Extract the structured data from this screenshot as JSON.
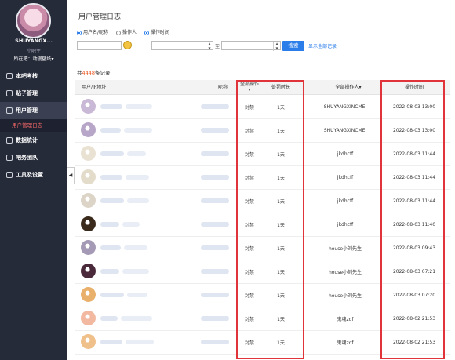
{
  "profile": {
    "username": "SHUYANGX...",
    "role": "小吧主",
    "bar_label": "所在吧：动漫壁纸",
    "bar_caret": "▾"
  },
  "sidebar": {
    "items": [
      {
        "label": "本吧考核",
        "icon": "doc-icon"
      },
      {
        "label": "贴子管理",
        "icon": "post-icon"
      },
      {
        "label": "用户管理",
        "icon": "user-icon",
        "active": true
      },
      {
        "label": "数据统计",
        "icon": "chart-icon"
      },
      {
        "label": "吧务团队",
        "icon": "team-icon"
      },
      {
        "label": "工具及设置",
        "icon": "gear-icon"
      }
    ],
    "sub_item": "用户管理日志"
  },
  "page": {
    "title": "用户管理日志"
  },
  "filters": {
    "radios": [
      {
        "label": "用户名/昵称",
        "checked": true
      },
      {
        "label": "操作人",
        "checked": false
      },
      {
        "label": "操作时间",
        "checked": true
      }
    ],
    "date_sep": "至",
    "search_button": "搜索",
    "show_all": "显示全部记录"
  },
  "summary": {
    "prefix": "共",
    "count": "4448",
    "suffix": "条记录"
  },
  "table": {
    "headers": {
      "user": "用户/IP地址",
      "nick": "昵称",
      "op": "全部操作",
      "duration": "处罚时长",
      "operator": "全部操作人",
      "time": "操作时间",
      "caret": "▾"
    },
    "rows": [
      {
        "avatar": "#c9b8d6",
        "op": "封禁",
        "duration": "1天",
        "operator": "SHUYANGXINCMEI",
        "time": "2022-08-03 13:00"
      },
      {
        "avatar": "#b8a6c9",
        "op": "封禁",
        "duration": "1天",
        "operator": "SHUYANGXINCMEI",
        "time": "2022-08-03 13:00"
      },
      {
        "avatar": "#e9e2d2",
        "op": "封禁",
        "duration": "1天",
        "operator": "jkdhcff",
        "time": "2022-08-03 11:44"
      },
      {
        "avatar": "#e4dccb",
        "op": "封禁",
        "duration": "1天",
        "operator": "jkdhcff",
        "time": "2022-08-03 11:44"
      },
      {
        "avatar": "#ddd4c8",
        "op": "封禁",
        "duration": "1天",
        "operator": "jkdhcff",
        "time": "2022-08-03 11:44"
      },
      {
        "avatar": "#3a2a1c",
        "op": "封禁",
        "duration": "1天",
        "operator": "jkdhcff",
        "time": "2022-08-03 11:40"
      },
      {
        "avatar": "#a49ab5",
        "op": "封禁",
        "duration": "1天",
        "operator": "house小刘先生",
        "time": "2022-08-03 09:43"
      },
      {
        "avatar": "#4a2a3a",
        "op": "封禁",
        "duration": "1天",
        "operator": "house小刘先生",
        "time": "2022-08-03 07:21"
      },
      {
        "avatar": "#e8b06a",
        "op": "封禁",
        "duration": "1天",
        "operator": "house小刘先生",
        "time": "2022-08-03 07:20"
      },
      {
        "avatar": "#f2b8a0",
        "op": "封禁",
        "duration": "1天",
        "operator": "鬼魂zdf",
        "time": "2022-08-02 21:53"
      },
      {
        "avatar": "#f0c08a",
        "op": "封禁",
        "duration": "1天",
        "operator": "鬼魂zdf",
        "time": "2022-08-02 21:53"
      }
    ]
  },
  "colors": {
    "sidebar_bg": "#262b3a",
    "accent": "#2b7de9",
    "highlight_red": "#e0343a",
    "count_orange": "#e8541e"
  }
}
